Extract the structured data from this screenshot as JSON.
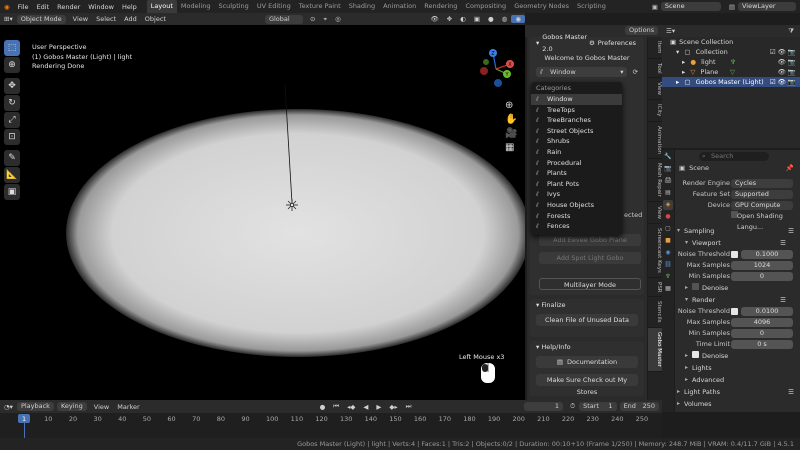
{
  "menu": [
    "File",
    "Edit",
    "Render",
    "Window",
    "Help"
  ],
  "workspaces": [
    "Layout",
    "Modeling",
    "Sculpting",
    "UV Editing",
    "Texture Paint",
    "Shading",
    "Animation",
    "Rendering",
    "Compositing",
    "Geometry Nodes",
    "Scripting"
  ],
  "active_workspace": "Layout",
  "scene_name": "Scene",
  "view_layer": "ViewLayer",
  "viewport_header": {
    "mode": "Object Mode",
    "menus": [
      "View",
      "Select",
      "Add",
      "Object"
    ],
    "transform": "Global",
    "options_label": "Options"
  },
  "viewport_info": {
    "line1": "User Perspective",
    "line2": "(1) Gobos Master (Light) | light",
    "line3": "Rendering Done"
  },
  "gizmo": {
    "x": "X",
    "y": "Y",
    "z": "Z"
  },
  "mouse_hint": "Left Mouse x3",
  "gobos_panel": {
    "title": "Gobos Master 2.0",
    "prefs_label": "Preferences",
    "welcome": "Welcome to Gobos Master",
    "dropdown_value": "Window",
    "obscured_text": "ected",
    "add_eevee": "Add Eevee Gobo Plane",
    "add_spot": "Add Spot Light Gobo",
    "multilayer": "Multilayer Mode",
    "finalize_title": "Finalize",
    "clean": "Clean File of Unused Data",
    "help_title": "Help/Info",
    "documentation": "Documentation",
    "stores": "Make Sure Check out My Stores"
  },
  "dropdown": {
    "header": "Categories",
    "items": [
      "Window",
      "TreeTops",
      "TreeBranches",
      "Street Objects",
      "Shrubs",
      "Rain",
      "Procedural",
      "Plants",
      "Plant Pots",
      "Ivys",
      "House Objects",
      "Forests",
      "Fences"
    ],
    "highlighted": "Window"
  },
  "side_tabs": [
    "Item",
    "Tool",
    "View",
    "ICity",
    "Animation",
    "Mesh Repair",
    "View",
    "Screencast Keys",
    "PSR",
    "Stencils",
    "Gobo Master"
  ],
  "outliner": {
    "root": "Scene Collection",
    "rows": [
      {
        "label": "Collection",
        "indent": 1
      },
      {
        "label": "light",
        "indent": 2
      },
      {
        "label": "Plane",
        "indent": 2
      },
      {
        "label": "Gobos Master (Light)",
        "indent": 1,
        "selected": true
      }
    ]
  },
  "properties": {
    "search_placeholder": "Search",
    "context": "Scene",
    "render_engine_label": "Render Engine",
    "render_engine": "Cycles",
    "feature_set_label": "Feature Set",
    "feature_set": "Supported",
    "device_label": "Device",
    "device": "GPU Compute",
    "osl_label": "Open Shading Langu...",
    "sampling": "Sampling",
    "viewport": "Viewport",
    "noise_threshold_label": "Noise Threshold",
    "noise_threshold_vp": "0.1000",
    "max_samples_label": "Max Samples",
    "max_samples_vp": "1024",
    "min_samples_label": "Min Samples",
    "min_samples_vp": "0",
    "denoise": "Denoise",
    "render": "Render",
    "noise_threshold_r": "0.0100",
    "max_samples_r": "4096",
    "min_samples_r": "0",
    "time_limit_label": "Time Limit",
    "time_limit": "0 s",
    "lights": "Lights",
    "advanced": "Advanced",
    "light_paths": "Light Paths",
    "volumes": "Volumes"
  },
  "timeline": {
    "menus": [
      "Playback",
      "Keying",
      "View",
      "Marker"
    ],
    "current": "1",
    "start_label": "Start",
    "start": "1",
    "end_label": "End",
    "end": "250",
    "ticks": [
      "1",
      "10",
      "20",
      "30",
      "40",
      "50",
      "60",
      "70",
      "80",
      "90",
      "100",
      "110",
      "120",
      "130",
      "140",
      "150",
      "160",
      "170",
      "180",
      "190",
      "200",
      "210",
      "220",
      "230",
      "240",
      "250"
    ]
  },
  "status_bar": "Gobos Master (Light) | light | Verts:4 | Faces:1 | Tris:2 | Objects:0/2 | Duration: 00:10+10 (Frame 1/250) | Memory: 248.7 MiB | VRAM: 0.4/11.7 GiB | 4.5.1",
  "colors": {
    "accent": "#4772b3",
    "selection": "#334d80",
    "light_disc": "#d4d4d4"
  }
}
